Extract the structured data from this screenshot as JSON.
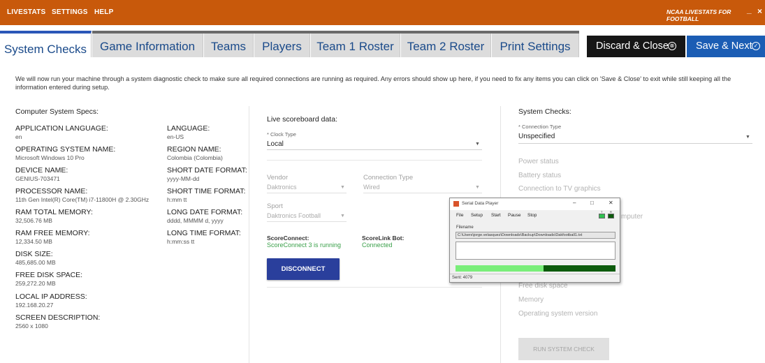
{
  "topbar": {
    "menu": [
      "LIVESTATS",
      "SETTINGS",
      "HELP"
    ],
    "app_title": "NCAA LIVESTATS FOR FOOTBALL",
    "minimize": "_",
    "close": "×"
  },
  "tabs": [
    {
      "label": "System Checks",
      "active": true
    },
    {
      "label": "Game Information",
      "active": false
    },
    {
      "label": "Teams",
      "active": false
    },
    {
      "label": "Players",
      "active": false
    },
    {
      "label": "Team 1 Roster",
      "active": false
    },
    {
      "label": "Team 2 Roster",
      "active": false
    },
    {
      "label": "Print Settings",
      "active": false
    }
  ],
  "actions": {
    "discard_label": "Discard & Close",
    "discard_icon": "⊗",
    "save_label": "Save & Next",
    "save_icon": "✓"
  },
  "intro": "We will now run your machine through a system diagnostic check to make sure all required connections are running as required. Any errors should show up here, if you need to fix any items you can click on 'Save & Close' to exit while still keeping all the information entered during setup.",
  "specs": {
    "title": "Computer System Specs:",
    "left": [
      {
        "label": "APPLICATION LANGUAGE:",
        "value": "en"
      },
      {
        "label": "OPERATING SYSTEM NAME:",
        "value": "Microsoft Windows 10 Pro"
      },
      {
        "label": "DEVICE NAME:",
        "value": "GENIUS-703471"
      },
      {
        "label": "PROCESSOR NAME:",
        "value": "11th Gen Intel(R) Core(TM) i7-11800H @ 2.30GHz"
      },
      {
        "label": "RAM TOTAL MEMORY:",
        "value": "32,506.76 MB"
      },
      {
        "label": "RAM FREE MEMORY:",
        "value": "12,334.50 MB"
      },
      {
        "label": "DISK SIZE:",
        "value": "485,685.00 MB"
      },
      {
        "label": "FREE DISK SPACE:",
        "value": "259,272.20 MB"
      },
      {
        "label": "LOCAL IP ADDRESS:",
        "value": "192.168.20.27"
      },
      {
        "label": "SCREEN DESCRIPTION:",
        "value": "2560 x 1080"
      }
    ],
    "right": [
      {
        "label": "LANGUAGE:",
        "value": "en-US"
      },
      {
        "label": "REGION NAME:",
        "value": "Colombia (Colombia)"
      },
      {
        "label": "SHORT DATE FORMAT:",
        "value": "yyyy-MM-dd"
      },
      {
        "label": "SHORT TIME FORMAT:",
        "value": "h:mm tt"
      },
      {
        "label": "LONG DATE FORMAT:",
        "value": "dddd, MMMM d, yyyy"
      },
      {
        "label": "LONG TIME FORMAT:",
        "value": "h:mm:ss tt"
      }
    ]
  },
  "scoreboard": {
    "title": "Live scoreboard data:",
    "clock_type_label": "* Clock Type",
    "clock_type_value": "Local",
    "vendor_label": "Vendor",
    "vendor_value": "Daktronics",
    "connection_label": "Connection Type",
    "connection_value": "Wired",
    "sport_label": "Sport",
    "sport_value": "Daktronics Football",
    "scoreconnect_label": "ScoreConnect:",
    "scoreconnect_value": "ScoreConnect 3 is running",
    "scorelink_label": "ScoreLink Bot:",
    "scorelink_value": "Connected",
    "disconnect_label": "DISCONNECT"
  },
  "system_checks": {
    "title": "System Checks:",
    "connection_type_label": "* Connection Type",
    "connection_type_value": "Unspecified",
    "items_top": [
      "Power status",
      "Battery status",
      "Connection to TV graphics"
    ],
    "item_partial": "mputer",
    "items_bottom": [
      "Free disk space",
      "Memory",
      "Operating system version"
    ],
    "run_label": "RUN SYSTEM CHECK"
  },
  "serial_player": {
    "title": "Serial Data Player",
    "menu": [
      "File",
      "Setup",
      "Start",
      "Pause",
      "Stop"
    ],
    "led_labels": [
      "T",
      "R"
    ],
    "filename_label": "Filename",
    "filename_value": "C:\\Users\\jorge.velasquez\\Downloads\\Backup\\Downloads\\Dakfootball1.txt",
    "progress": 0.55,
    "status": "Sent: 4079"
  },
  "colors": {
    "topbar": "#c8590b",
    "accent": "#2b57b8",
    "save": "#1b5db4",
    "discard": "#161616",
    "disconnect": "#2a3f9c",
    "ok_green": "#3aa04a"
  }
}
